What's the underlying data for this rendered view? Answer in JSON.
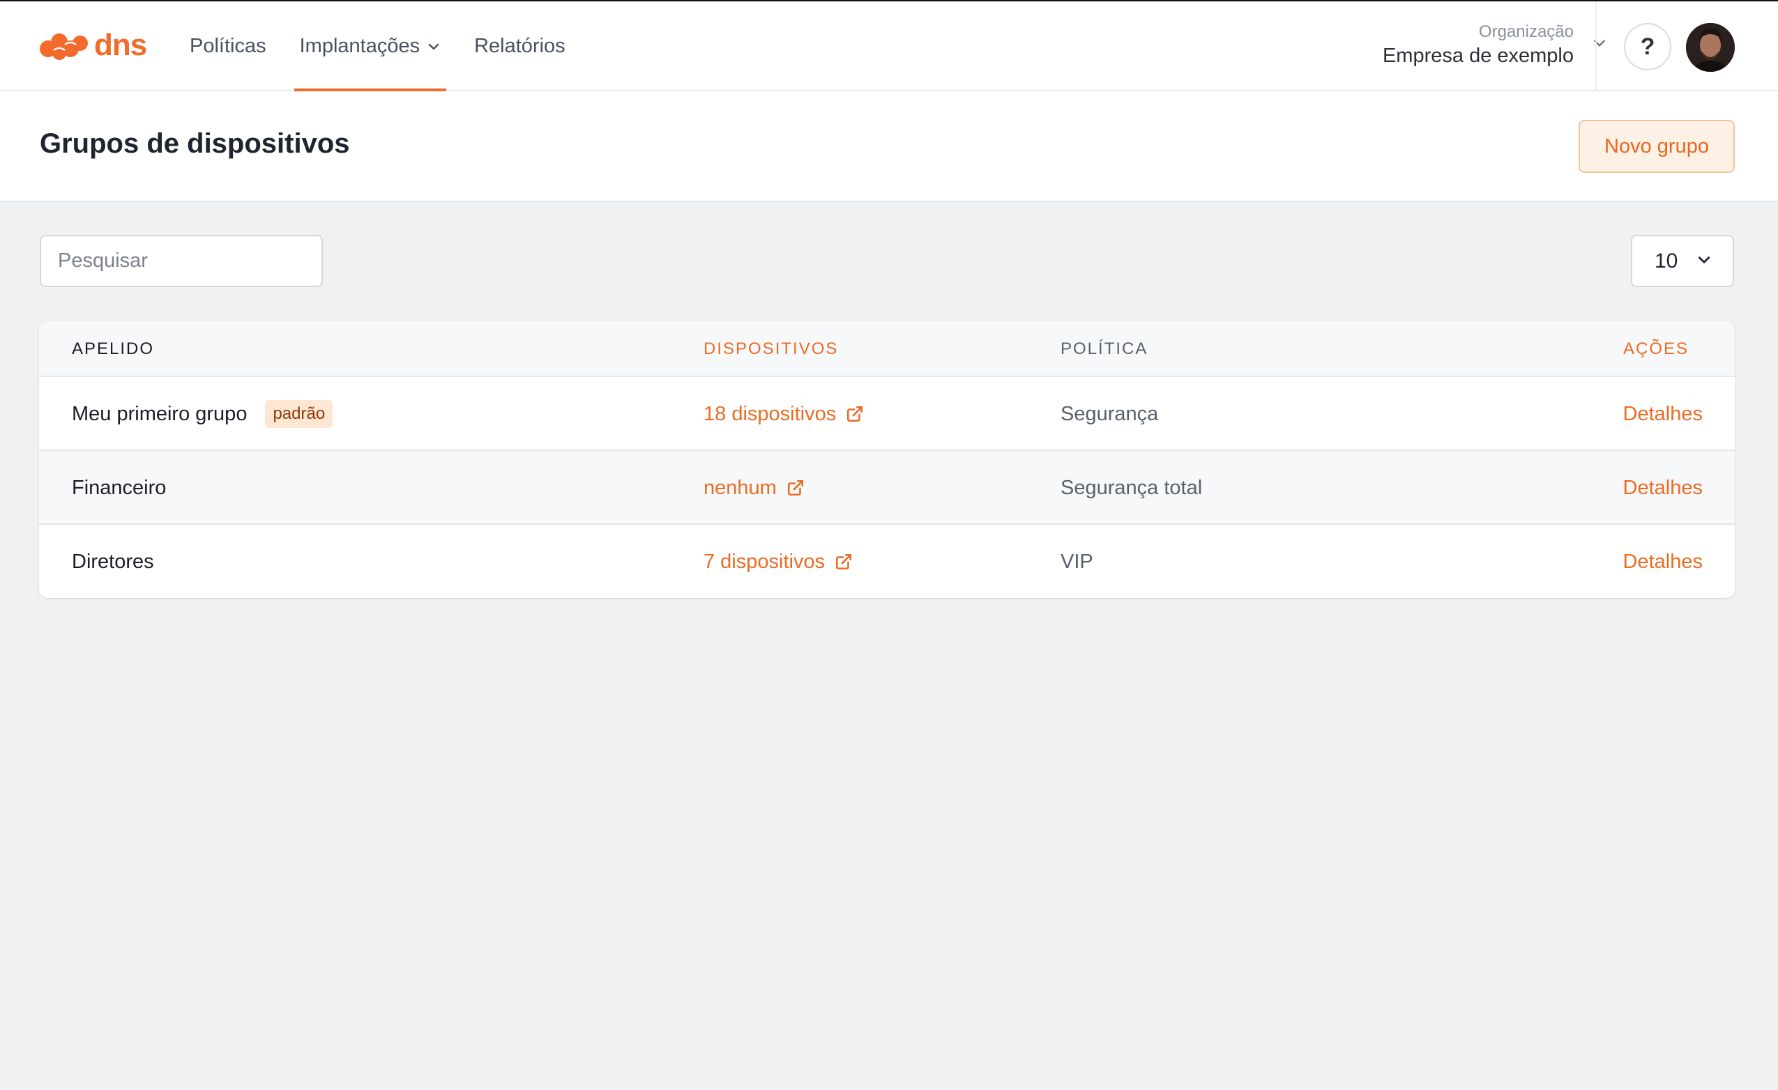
{
  "brand": {
    "name": "dns",
    "accent": "#f26b2a"
  },
  "nav": {
    "items": [
      {
        "label": "Políticas"
      },
      {
        "label": "Implantações"
      },
      {
        "label": "Relatórios"
      }
    ]
  },
  "org": {
    "label": "Organização",
    "name": "Empresa de exemplo"
  },
  "help": {
    "label": "?"
  },
  "page": {
    "title": "Grupos de dispositivos",
    "new_button": "Novo grupo"
  },
  "search": {
    "placeholder": "Pesquisar",
    "value": ""
  },
  "page_size": {
    "value": "10"
  },
  "table": {
    "headers": [
      "APELIDO",
      "DISPOSITIVOS",
      "POLÍTICA",
      "AÇÕES"
    ],
    "rows": [
      {
        "name": "Meu primeiro grupo",
        "badge": "padrão",
        "devices": "18 dispositivos",
        "policy": "Segurança",
        "action": "Detalhes"
      },
      {
        "name": "Financeiro",
        "devices": "nenhum",
        "policy": "Segurança total",
        "action": "Detalhes"
      },
      {
        "name": "Diretores",
        "devices": "7 dispositivos",
        "policy": "VIP",
        "action": "Detalhes"
      }
    ]
  }
}
